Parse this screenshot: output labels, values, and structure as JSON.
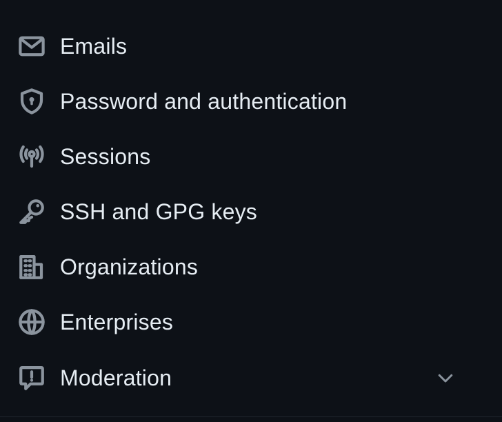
{
  "colors": {
    "background": "#0d1117",
    "text": "#e6edf3",
    "icon": "#8b949e"
  },
  "nav": {
    "items": [
      {
        "label": "Emails",
        "icon": "mail-icon"
      },
      {
        "label": "Password and authentication",
        "icon": "shield-lock-icon"
      },
      {
        "label": "Sessions",
        "icon": "broadcast-icon"
      },
      {
        "label": "SSH and GPG keys",
        "icon": "key-icon"
      },
      {
        "label": "Organizations",
        "icon": "organization-icon"
      },
      {
        "label": "Enterprises",
        "icon": "globe-icon"
      },
      {
        "label": "Moderation",
        "icon": "report-icon",
        "expand_icon": "chevron-down-icon"
      }
    ]
  }
}
